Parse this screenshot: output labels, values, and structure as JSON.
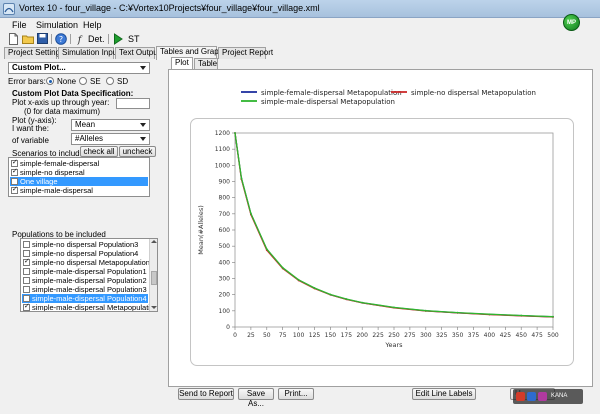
{
  "window": {
    "title": "Vortex 10 - four_village - C:¥Vortex10Projects¥four_village¥four_village.xml"
  },
  "menu": {
    "items": [
      "File",
      "Simulation",
      "Help"
    ]
  },
  "logo": {
    "text": "MP"
  },
  "toolbar": {
    "det_label": "Det.",
    "st_label": "ST"
  },
  "main_tabs": [
    "Project Settings",
    "Simulation Input",
    "Text Output",
    "Tables and Graphs",
    "Project Report"
  ],
  "left": {
    "plot_type": "Custom Plot...",
    "error_bars_label": "Error bars:",
    "error_bar_options": [
      "None",
      "SE",
      "SD"
    ],
    "spec_heading": "Custom Plot Data Specification:",
    "x_axis_label": "Plot x-axis up through year:",
    "x_axis_hint": "(0 for data maximum)",
    "y_axis_label": "Plot (y-axis):",
    "i_want_label": "I want the:",
    "i_want_value": "Mean",
    "of_variable_label": "of variable",
    "variable_value": "#Alleles",
    "scenarios_label": "Scenarios to include:",
    "check_all": "check all",
    "uncheck": "uncheck",
    "scenarios": [
      {
        "label": "simple-female-dispersal",
        "checked": true,
        "selected": false
      },
      {
        "label": "simple-no dispersal",
        "checked": true,
        "selected": false
      },
      {
        "label": "One village",
        "checked": false,
        "selected": true
      },
      {
        "label": "simple-male-dispersal",
        "checked": true,
        "selected": false
      }
    ],
    "populations_label": "Populations to be included",
    "populations": [
      {
        "label": "simple-no dispersal Population3",
        "checked": false,
        "selected": false
      },
      {
        "label": "simple-no dispersal Population4",
        "checked": false,
        "selected": false
      },
      {
        "label": "simple-no dispersal Metapopulation",
        "checked": true,
        "selected": false
      },
      {
        "label": "simple-male-dispersal Population1",
        "checked": false,
        "selected": false
      },
      {
        "label": "simple-male-dispersal Population2",
        "checked": false,
        "selected": false
      },
      {
        "label": "simple-male-dispersal Population3",
        "checked": false,
        "selected": false
      },
      {
        "label": "simple-male-dispersal Population4",
        "checked": false,
        "selected": true
      },
      {
        "label": "simple-male-dispersal Metapopulation",
        "checked": true,
        "selected": false
      }
    ]
  },
  "right": {
    "sub_tabs": [
      "Plot",
      "Table"
    ],
    "buttons": {
      "send_to_report": "Send to Report",
      "save_as": "Save As...",
      "print": "Print...",
      "edit_line_labels": "Edit Line Labels",
      "partial": "U"
    }
  },
  "tray": {
    "text": "KANA"
  },
  "chart_data": {
    "type": "line",
    "title": "",
    "xlabel": "Years",
    "ylabel": "Mean(#Alleles)",
    "xlim": [
      0,
      500
    ],
    "ylim": [
      0,
      1200
    ],
    "xticks": [
      0,
      25,
      50,
      75,
      100,
      125,
      150,
      175,
      200,
      225,
      250,
      275,
      300,
      325,
      350,
      375,
      400,
      425,
      450,
      475,
      500
    ],
    "yticks": [
      0,
      100,
      200,
      300,
      400,
      500,
      600,
      700,
      800,
      900,
      1000,
      1100,
      1200
    ],
    "legend_position": "top",
    "x": [
      0,
      10,
      25,
      50,
      75,
      100,
      125,
      150,
      175,
      200,
      250,
      300,
      350,
      400,
      450,
      500
    ],
    "series": [
      {
        "name": "simple-female-dispersal Metapopulation",
        "color": "#1f2f9e",
        "values": [
          1200,
          920,
          700,
          480,
          365,
          290,
          240,
          200,
          172,
          150,
          120,
          100,
          88,
          78,
          70,
          63
        ]
      },
      {
        "name": "simple-no dispersal Metapopulation",
        "color": "#cc2a2a",
        "values": [
          1200,
          915,
          695,
          475,
          362,
          288,
          238,
          199,
          171,
          149,
          119,
          99,
          87,
          77,
          69,
          62
        ]
      },
      {
        "name": "simple-male-dispersal Metapopulation",
        "color": "#2fb52f",
        "values": [
          1200,
          922,
          702,
          482,
          367,
          292,
          241,
          201,
          173,
          151,
          121,
          101,
          89,
          79,
          71,
          64
        ]
      }
    ]
  }
}
